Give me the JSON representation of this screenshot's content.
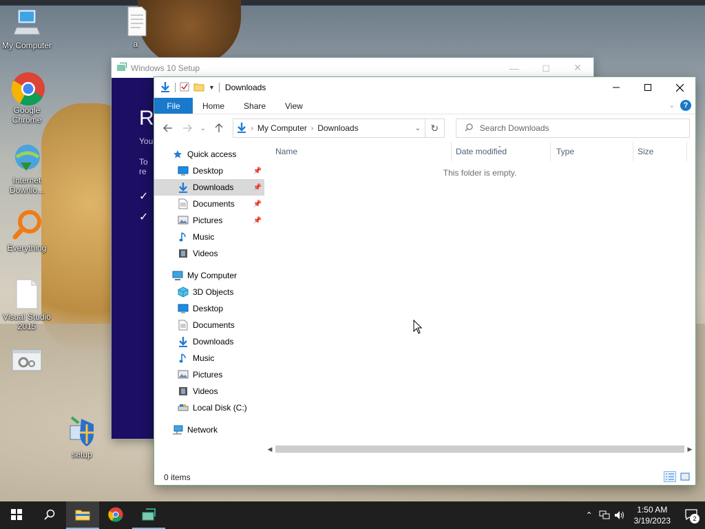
{
  "desktop": {
    "icons": [
      {
        "label": "My Computer",
        "icon": "computer-icon"
      },
      {
        "label": "Google Chrome",
        "icon": "chrome-icon"
      },
      {
        "label": "Internet Downlo...",
        "icon": "idm-icon"
      },
      {
        "label": "Everything",
        "icon": "everything-icon"
      },
      {
        "label": "Visual Studio 2015",
        "icon": "blank-document-icon"
      },
      {
        "label": "",
        "icon": "settings-window-icon"
      },
      {
        "label": "a",
        "icon": "document-icon"
      },
      {
        "label": "setup",
        "icon": "setup-icon"
      }
    ]
  },
  "setup_window": {
    "title": "Windows 10 Setup",
    "heading_fragment": "Re",
    "line1_fragment": "You",
    "line2_fragment": "To re",
    "check": "✓"
  },
  "explorer": {
    "title": "Downloads",
    "ribbon_tabs": [
      "File",
      "Home",
      "Share",
      "View"
    ],
    "help": "?",
    "address": {
      "segments": [
        "My Computer",
        "Downloads"
      ]
    },
    "search_placeholder": "Search Downloads",
    "quick_access": {
      "label": "Quick access",
      "items": [
        {
          "label": "Desktop",
          "icon": "desktop-icon",
          "pinned": true
        },
        {
          "label": "Downloads",
          "icon": "downloads-icon",
          "pinned": true,
          "selected": true
        },
        {
          "label": "Documents",
          "icon": "documents-icon",
          "pinned": true
        },
        {
          "label": "Pictures",
          "icon": "pictures-icon",
          "pinned": true
        },
        {
          "label": "Music",
          "icon": "music-icon",
          "pinned": false
        },
        {
          "label": "Videos",
          "icon": "videos-icon",
          "pinned": false
        }
      ]
    },
    "this_pc": {
      "label": "My Computer",
      "items": [
        {
          "label": "3D Objects",
          "icon": "3d-objects-icon"
        },
        {
          "label": "Desktop",
          "icon": "desktop-icon"
        },
        {
          "label": "Documents",
          "icon": "documents-icon"
        },
        {
          "label": "Downloads",
          "icon": "downloads-icon"
        },
        {
          "label": "Music",
          "icon": "music-icon"
        },
        {
          "label": "Pictures",
          "icon": "pictures-icon"
        },
        {
          "label": "Videos",
          "icon": "videos-icon"
        },
        {
          "label": "Local Disk (C:)",
          "icon": "local-disk-icon"
        }
      ]
    },
    "network": {
      "label": "Network"
    },
    "columns": [
      "Name",
      "Date modified",
      "Type",
      "Size"
    ],
    "empty_message": "This folder is empty.",
    "status": "0 items",
    "accent_color": "#1979ca"
  },
  "taskbar": {
    "apps": [
      "start-icon",
      "search-icon",
      "file-explorer-icon",
      "chrome-icon",
      "setup-icon"
    ],
    "clock_time": "1:50 AM",
    "clock_date": "3/19/2023",
    "notification_count": "2"
  }
}
